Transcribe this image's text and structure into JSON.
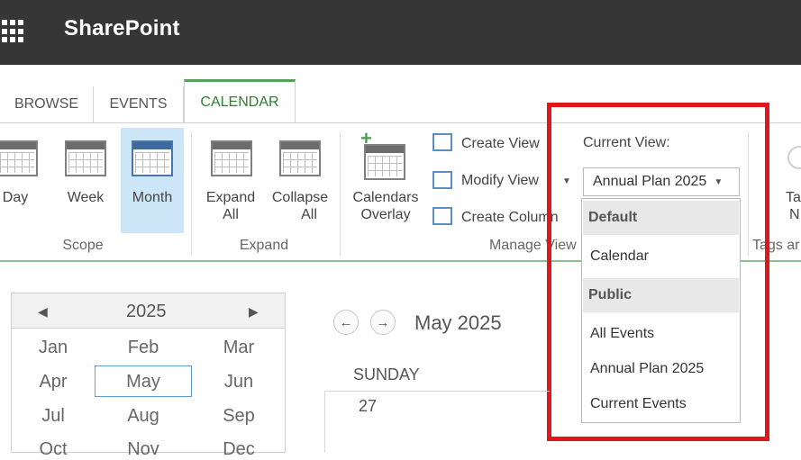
{
  "app": {
    "title": "SharePoint"
  },
  "tabs": [
    "BROWSE",
    "EVENTS",
    "CALENDAR"
  ],
  "ribbon": {
    "scope": {
      "label": "Scope",
      "buttons": [
        "Day",
        "Week",
        "Month"
      ]
    },
    "expand": {
      "label": "Expand",
      "expand_all": [
        "Expand",
        "All"
      ],
      "collapse_all": [
        "Collapse",
        "All"
      ]
    },
    "calendars_overlay": [
      "Calendars",
      "Overlay"
    ],
    "manage_views": {
      "label": "Manage View",
      "create_view": "Create View",
      "modify_view": "Modify View",
      "create_column": "Create Column"
    },
    "tags": {
      "label": "Tags ar",
      "button": [
        "Ta",
        "N"
      ]
    }
  },
  "current_view": {
    "label": "Current View:",
    "selected": "Annual Plan 2025",
    "dropdown": {
      "default_header": "Default",
      "default_items": [
        "Calendar"
      ],
      "public_header": "Public",
      "public_items": [
        "All Events",
        "Annual Plan 2025",
        "Current Events"
      ]
    }
  },
  "date_picker": {
    "year": "2025",
    "months": [
      [
        "Jan",
        "Feb",
        "Mar"
      ],
      [
        "Apr",
        "May",
        "Jun"
      ],
      [
        "Jul",
        "Aug",
        "Sep"
      ],
      [
        "Oct",
        "Nov",
        "Dec"
      ]
    ],
    "selected_month": "May"
  },
  "calendar": {
    "month_title": "May 2025",
    "day_header": "SUNDAY",
    "first_date": "27"
  },
  "colors": {
    "suitebar": "#363636",
    "active_tab": "#2f7d32",
    "highlight": "#e0161e",
    "selected_bg": "#cde6f7"
  }
}
